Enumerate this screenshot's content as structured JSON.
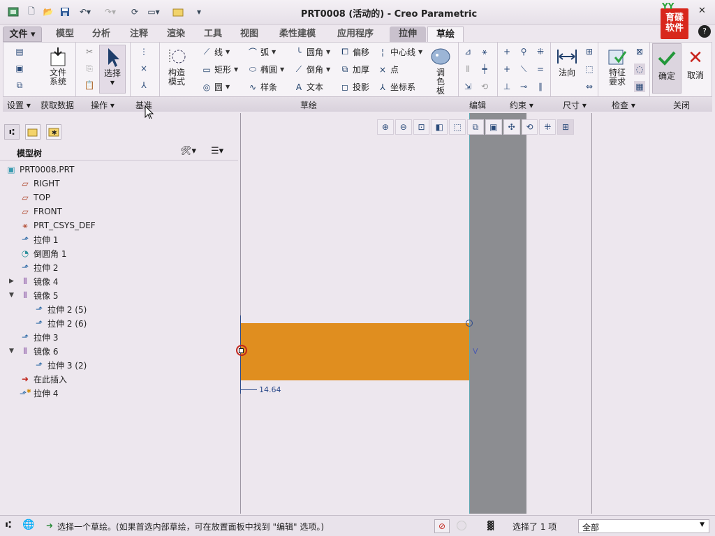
{
  "app": {
    "title": "PRT0008 (活动的) - Creo Parametric",
    "logo_text": "育碟软件"
  },
  "tabs": [
    "文件 ▾",
    "模型",
    "分析",
    "注释",
    "渲染",
    "工具",
    "视图",
    "柔性建模",
    "应用程序",
    "拉伸",
    "草绘"
  ],
  "ribbon": {
    "settings": {
      "file_system": "文件系统"
    },
    "operations": {
      "select": "选择"
    },
    "construction": {
      "mode": "构造模式"
    },
    "sketch": {
      "line": "线",
      "arc": "弧",
      "fillet": "圆角",
      "offset": "偏移",
      "centerline": "中心线",
      "rectangle": "矩形",
      "ellipse": "椭圆",
      "chamfer": "倒角",
      "thicken": "加厚",
      "point": "点",
      "circle": "圆",
      "spline": "样条",
      "text": "文本",
      "project": "投影",
      "coord_sys": "坐标系",
      "palette": "调色板"
    },
    "dimension": {
      "normal": "法向"
    },
    "inspect": {
      "feature_req": "特征要求"
    },
    "close": {
      "ok": "确定",
      "cancel": "取消"
    }
  },
  "groups": {
    "settings": "设置 ▾",
    "get_data": "获取数据",
    "operations": "操作 ▾",
    "datum": "基准",
    "sketch": "草绘",
    "edit": "编辑",
    "constrain": "约束 ▾",
    "dimension": "尺寸 ▾",
    "inspect": "检查 ▾",
    "close": "关闭"
  },
  "model_tree": {
    "title": "模型树",
    "nodes": [
      {
        "label": "PRT0008.PRT",
        "icon": "part-icon"
      },
      {
        "label": "RIGHT",
        "icon": "datum-plane-icon"
      },
      {
        "label": "TOP",
        "icon": "datum-plane-icon"
      },
      {
        "label": "FRONT",
        "icon": "datum-plane-icon"
      },
      {
        "label": "PRT_CSYS_DEF",
        "icon": "csys-icon"
      },
      {
        "label": "拉伸 1",
        "icon": "extrude-icon"
      },
      {
        "label": "倒圆角 1",
        "icon": "round-icon"
      },
      {
        "label": "拉伸 2",
        "icon": "extrude-icon"
      },
      {
        "label": "镜像 4",
        "icon": "mirror-icon"
      },
      {
        "label": "镜像 5",
        "icon": "mirror-icon"
      },
      {
        "label": "拉伸 2 (5)",
        "icon": "extrude-icon"
      },
      {
        "label": "拉伸 2 (6)",
        "icon": "extrude-icon"
      },
      {
        "label": "拉伸 3",
        "icon": "extrude-icon"
      },
      {
        "label": "镜像 6",
        "icon": "mirror-icon"
      },
      {
        "label": "拉伸 3 (2)",
        "icon": "extrude-icon"
      },
      {
        "label": "在此插入",
        "icon": "insert-arrow-icon"
      },
      {
        "label": "拉伸 4",
        "icon": "extrude-new-icon"
      }
    ]
  },
  "canvas": {
    "dimension_value": "14.64",
    "constraint_label": "V"
  },
  "status": {
    "message": "选择一个草绘。(如果首选内部草绘，可在放置面板中找到 \"编辑\" 选项。)",
    "selection_count": "选择了 1 项",
    "filter_value": "全部"
  }
}
